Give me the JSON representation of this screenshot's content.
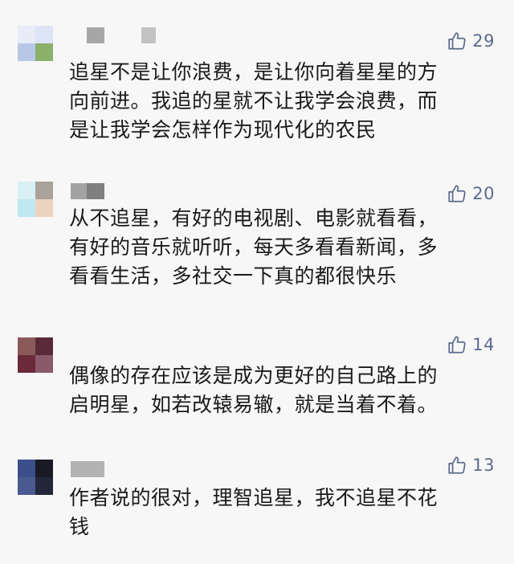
{
  "comments": [
    {
      "avatar_colors": [
        "#e8ecf7",
        "#dde4f5",
        "#b7c7e6",
        "#8bb06a"
      ],
      "name_colors": [
        "#a6a6a6",
        "#c2c2c2"
      ],
      "likes": "29",
      "text": "追星不是让你浪费，是让你向着星星的方\n向前进。我追的星就不让我学会浪费，而\n是让我学会怎样作为现代化的农民"
    },
    {
      "avatar_colors": [
        "#d9f0f4",
        "#a8a29a",
        "#bfe8ef",
        "#ecd3c0"
      ],
      "name_colors": [
        "#a3a3a3",
        "#7f7f7f"
      ],
      "likes": "20",
      "text": "从不追星，有好的电视剧、电影就看看，\n有好的音乐就听听，每天多看看新闻，多\n看看生活，多社交一下真的都很快乐"
    },
    {
      "avatar_colors": [
        "#8a5a5a",
        "#5a2a3a",
        "#6a2a3a",
        "#8a5a6a"
      ],
      "likes": "14",
      "text": "偶像的存在应该是成为更好的自己路上的\n启明星，如若改辕易辙，就是当着不着。"
    },
    {
      "avatar_colors": [
        "#3d4f8a",
        "#1a1a24",
        "#4a5a90",
        "#22263a"
      ],
      "name_colors": [
        "#b3b3b3"
      ],
      "likes": "13",
      "text": "作者说的很对，理智追星，我不追星不花\n钱"
    }
  ]
}
